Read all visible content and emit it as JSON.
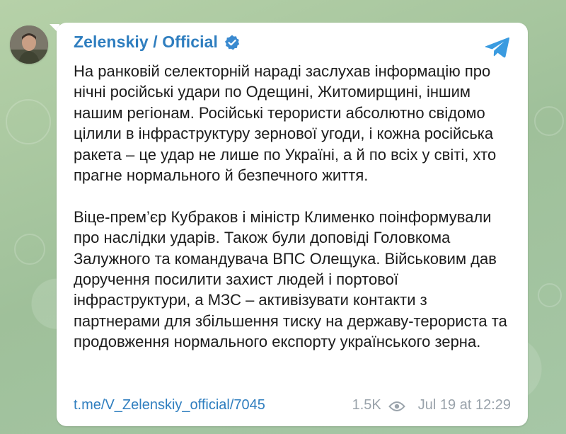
{
  "channel": {
    "name": "Zelenskiy / Official"
  },
  "message": {
    "paragraphs": [
      "На ранковій селекторній нараді заслухав інформацію про нічні російські удари по Одещині, Житомирщині, іншим нашим регіонам. Російські терористи абсолютно свідомо цілили в інфраструктуру зернової угоди, і кожна російська ракета – це удар не лише по Україні, а й по всіх у світі, хто прагне нормального й безпечного життя.",
      "Віце-прем’єр Кубраков і міністр Клименко поінформували про наслідки ударів. Також були доповіді Головкома Залужного та командувача ВПС Олещука. Військовим дав доручення посилити захист людей і портової інфраструктури, а МЗС – активізувати контакти з партнерами для збільшення тиску на державу-терориста та продовження нормального експорту українського зерна."
    ]
  },
  "footer": {
    "link": "t.me/V_Zelenskiy_official/7045",
    "views": "1.5K",
    "timestamp": "Jul 19 at 12:29"
  },
  "icons": {
    "verified": "verified-badge-icon",
    "share": "telegram-share-icon",
    "views": "eye-icon"
  },
  "colors": {
    "accent": "#2f7ebf",
    "text": "#1c1c1c",
    "meta": "#9aa3ab",
    "bubble": "#ffffff",
    "wallpaper": "#a8c8a0"
  }
}
